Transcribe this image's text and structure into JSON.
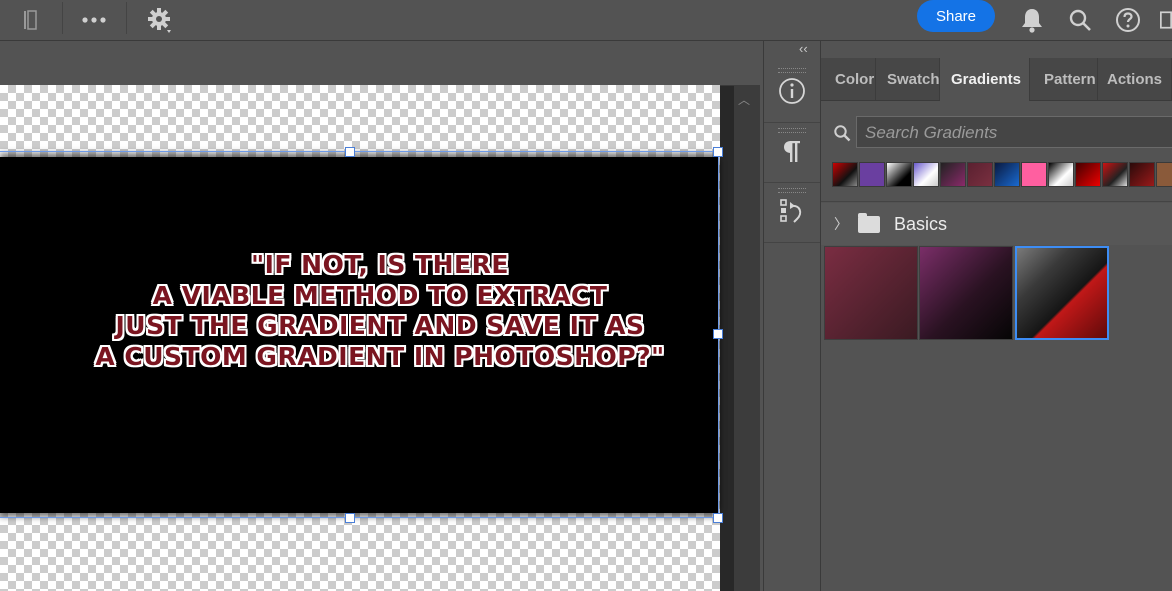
{
  "topbar": {
    "icons": [
      "panel-toggle-icon",
      "more-icon",
      "settings-icon",
      "bell-icon",
      "search-icon",
      "help-icon"
    ],
    "share_label": "Share"
  },
  "canvas": {
    "quote_lines": [
      "\"IF NOT, IS THERE",
      "A VIABLE METHOD TO EXTRACT",
      "JUST THE GRADIENT AND SAVE IT AS",
      "A CUSTOM GRADIENT IN PHOTOSHOP?\""
    ],
    "text_color": "#7a1520",
    "layer_color": "#000000"
  },
  "toolstrip": {
    "collapse_label": "‹‹",
    "tools": [
      "info-icon",
      "paragraph-icon",
      "history-icon"
    ]
  },
  "panel": {
    "tabs": [
      {
        "label": "Color",
        "active": false
      },
      {
        "label": "Swatch",
        "active": false
      },
      {
        "label": "Gradients",
        "active": true
      },
      {
        "label": "Pattern",
        "active": false
      },
      {
        "label": "Actions",
        "active": false
      }
    ],
    "search_placeholder": "Search Gradients",
    "recent_swatches": [
      "linear-gradient(135deg,#c00 0%,#111 60%,#888 100%)",
      "#6a3fa0",
      "linear-gradient(135deg,#fff 0%,#000 70%)",
      "linear-gradient(135deg,#6a5acd 0%,#fff 60%,#ccc 100%)",
      "linear-gradient(135deg,#222 0%,#8a2a6a 100%)",
      "linear-gradient(135deg,#5a2030 0%,#7a3040 100%)",
      "linear-gradient(135deg,#0a1a40 0%,#1a6ad0 100%)",
      "#ff5fa0",
      "linear-gradient(135deg,#000 0%,#fff 60%,#ccc 100%)",
      "linear-gradient(135deg,#400 0%,#e00 100%)",
      "linear-gradient(135deg,#c11 0%,#222 60%,#ddd 100%)",
      "linear-gradient(135deg,#2a0a0a 0%,#9a1a1a 100%)",
      "#8a5a3a",
      "linear-gradient(135deg,#0a8ad0 0%,#fff 100%)"
    ],
    "folder_label": "Basics",
    "gradient_tiles": [
      {
        "fill": "linear-gradient(135deg,#7a2d42 0%,#3a1a22 100%)",
        "selected": false
      },
      {
        "fill": "linear-gradient(135deg,#7a2e68 0%,#2a1222 55%,#050505 100%)",
        "selected": false
      },
      {
        "fill": "linear-gradient(135deg,#7a7a7a 0%,#3a3a3a 30%,#151515 58%,#c01818 60%,#600a0a 100%)",
        "selected": true
      }
    ]
  }
}
